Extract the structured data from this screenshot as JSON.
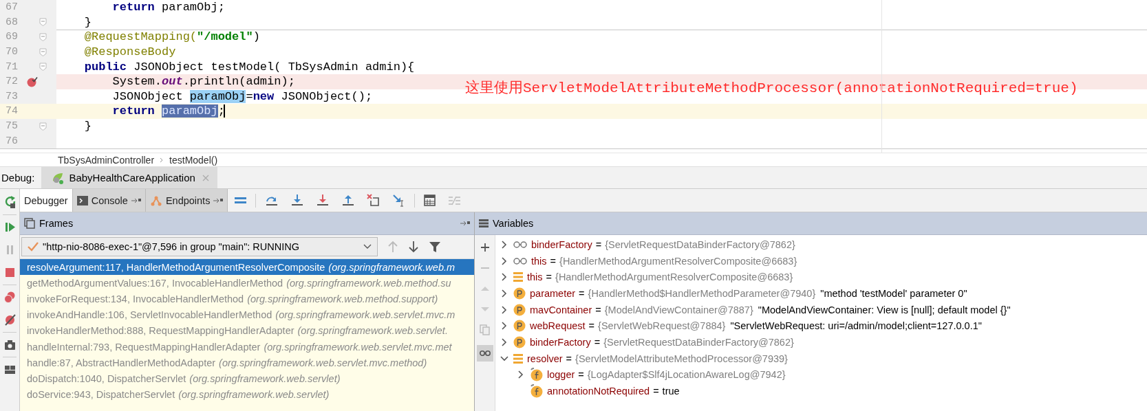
{
  "editor": {
    "lines": [
      {
        "number": "67",
        "fold": false,
        "separator": false,
        "breakpoint": false,
        "current": false,
        "segments": [
          {
            "text": "        return",
            "kind": "keyword"
          },
          {
            "text": " paramObj;",
            "kind": "plain"
          }
        ]
      },
      {
        "number": "68",
        "fold": true,
        "separator": true,
        "breakpoint": false,
        "current": false,
        "segments": [
          {
            "text": "    }",
            "kind": "plain"
          }
        ]
      },
      {
        "number": "69",
        "fold": true,
        "separator": false,
        "breakpoint": false,
        "current": false,
        "segments": [
          {
            "text": "    @RequestMapping(",
            "kind": "annotation"
          },
          {
            "text": "\"/model\"",
            "kind": "string"
          },
          {
            "text": ")",
            "kind": "plain"
          }
        ]
      },
      {
        "number": "70",
        "fold": true,
        "separator": false,
        "breakpoint": false,
        "current": false,
        "segments": [
          {
            "text": "    @ResponseBody",
            "kind": "annotation"
          }
        ]
      },
      {
        "number": "71",
        "fold": true,
        "separator": false,
        "breakpoint": false,
        "current": false,
        "segments": [
          {
            "text": "    public",
            "kind": "keyword"
          },
          {
            "text": " JSONObject testModel( TbSysAdmin admin){",
            "kind": "plain"
          }
        ]
      },
      {
        "number": "72",
        "fold": false,
        "separator": false,
        "breakpoint": true,
        "current": false,
        "segments": [
          {
            "text": "        System.",
            "kind": "plain"
          },
          {
            "text": "out",
            "kind": "field"
          },
          {
            "text": ".println(admin);",
            "kind": "plain"
          }
        ]
      },
      {
        "number": "73",
        "fold": false,
        "separator": false,
        "breakpoint": false,
        "current": false,
        "segments": [
          {
            "text": "        JSONObject ",
            "kind": "plain"
          },
          {
            "text": "paramObj",
            "kind": "usage"
          },
          {
            "text": "=",
            "kind": "plain"
          },
          {
            "text": "new",
            "kind": "keyword"
          },
          {
            "text": " JSONObject();",
            "kind": "plain"
          }
        ]
      },
      {
        "number": "74",
        "fold": false,
        "separator": false,
        "breakpoint": false,
        "current": true,
        "segments": [
          {
            "text": "        return ",
            "kind": "keyword"
          },
          {
            "text": "paramObj",
            "kind": "selection"
          },
          {
            "text": ";",
            "kind": "plain"
          }
        ]
      },
      {
        "number": "75",
        "fold": true,
        "separator": false,
        "breakpoint": false,
        "current": false,
        "segments": [
          {
            "text": "    }",
            "kind": "plain"
          }
        ]
      },
      {
        "number": "76",
        "fold": false,
        "separator": true,
        "breakpoint": false,
        "current": false
      }
    ],
    "annotation": "这里使用ServletModelAttributeMethodProcessor(annotationNotRequired=true)"
  },
  "breadcrumbs": [
    "TbSysAdminController",
    "testModel()"
  ],
  "debug": {
    "label": "Debug:",
    "session": "BabyHealthCareApplication",
    "tabs": [
      {
        "label": "Debugger",
        "selected": true,
        "kind": "plain"
      },
      {
        "label": "Console",
        "selected": false,
        "kind": "console"
      },
      {
        "label": "Endpoints",
        "selected": false,
        "kind": "endpoints"
      }
    ]
  },
  "frames": {
    "title": "Frames",
    "thread": "\"http-nio-8086-exec-1\"@7,596 in group \"main\": RUNNING",
    "items": [
      {
        "method": "resolveArgument:117, HandlerMethodArgumentResolverComposite",
        "package": "(org.springframework.web.m",
        "selected": true
      },
      {
        "method": "getMethodArgumentValues:167, InvocableHandlerMethod",
        "package": "(org.springframework.web.method.su",
        "selected": false
      },
      {
        "method": "invokeForRequest:134, InvocableHandlerMethod",
        "package": "(org.springframework.web.method.support)",
        "selected": false
      },
      {
        "method": "invokeAndHandle:106, ServletInvocableHandlerMethod",
        "package": "(org.springframework.web.servlet.mvc.m",
        "selected": false
      },
      {
        "method": "invokeHandlerMethod:888, RequestMappingHandlerAdapter",
        "package": "(org.springframework.web.servlet.",
        "selected": false
      },
      {
        "method": "handleInternal:793, RequestMappingHandlerAdapter",
        "package": "(org.springframework.web.servlet.mvc.met",
        "selected": false
      },
      {
        "method": "handle:87, AbstractHandlerMethodAdapter",
        "package": "(org.springframework.web.servlet.mvc.method)",
        "selected": false
      },
      {
        "method": "doDispatch:1040, DispatcherServlet",
        "package": "(org.springframework.web.servlet)",
        "selected": false
      },
      {
        "method": "doService:943, DispatcherServlet",
        "package": "(org.springframework.web.servlet)",
        "selected": false
      }
    ]
  },
  "variables": {
    "title": "Variables",
    "items": [
      {
        "kind": "watch",
        "name": "binderFactory",
        "operator": "=",
        "value": "{ServletRequestDataBinderFactory@7862}",
        "expandable": true,
        "expanded": false
      },
      {
        "kind": "watch",
        "name": "this",
        "operator": "=",
        "value": "{HandlerMethodArgumentResolverComposite@6683}",
        "expandable": true,
        "expanded": false
      },
      {
        "kind": "local",
        "name": "this",
        "operator": "=",
        "value": "{HandlerMethodArgumentResolverComposite@6683}",
        "expandable": true,
        "expanded": false
      },
      {
        "kind": "param",
        "name": "parameter",
        "operator": "=",
        "value": "{HandlerMethod$HandlerMethodParameter@7940}",
        "note": "\"method 'testModel' parameter 0\"",
        "expandable": true,
        "expanded": false
      },
      {
        "kind": "param",
        "name": "mavContainer",
        "operator": "=",
        "value": "{ModelAndViewContainer@7887}",
        "note": "\"ModelAndViewContainer: View is [null]; default model {}\"",
        "expandable": true,
        "expanded": false
      },
      {
        "kind": "param",
        "name": "webRequest",
        "operator": "=",
        "value": "{ServletWebRequest@7884}",
        "note": "\"ServletWebRequest: uri=/admin/model;client=127.0.0.1\"",
        "expandable": true,
        "expanded": false
      },
      {
        "kind": "param",
        "name": "binderFactory",
        "operator": "=",
        "value": "{ServletRequestDataBinderFactory@7862}",
        "expandable": true,
        "expanded": false
      },
      {
        "kind": "local",
        "name": "resolver",
        "operator": "=",
        "value": "{ServletModelAttributeMethodProcessor@7939}",
        "expandable": true,
        "expanded": true,
        "children": [
          {
            "kind": "field",
            "name": "logger",
            "operator": "=",
            "value": "{LogAdapter$Slf4jLocationAwareLog@7942}",
            "expandable": true,
            "expanded": false
          },
          {
            "kind": "field",
            "name": "annotationNotRequired",
            "operator": "=",
            "value": "true",
            "expandable": false,
            "expanded": false
          }
        ]
      }
    ]
  }
}
